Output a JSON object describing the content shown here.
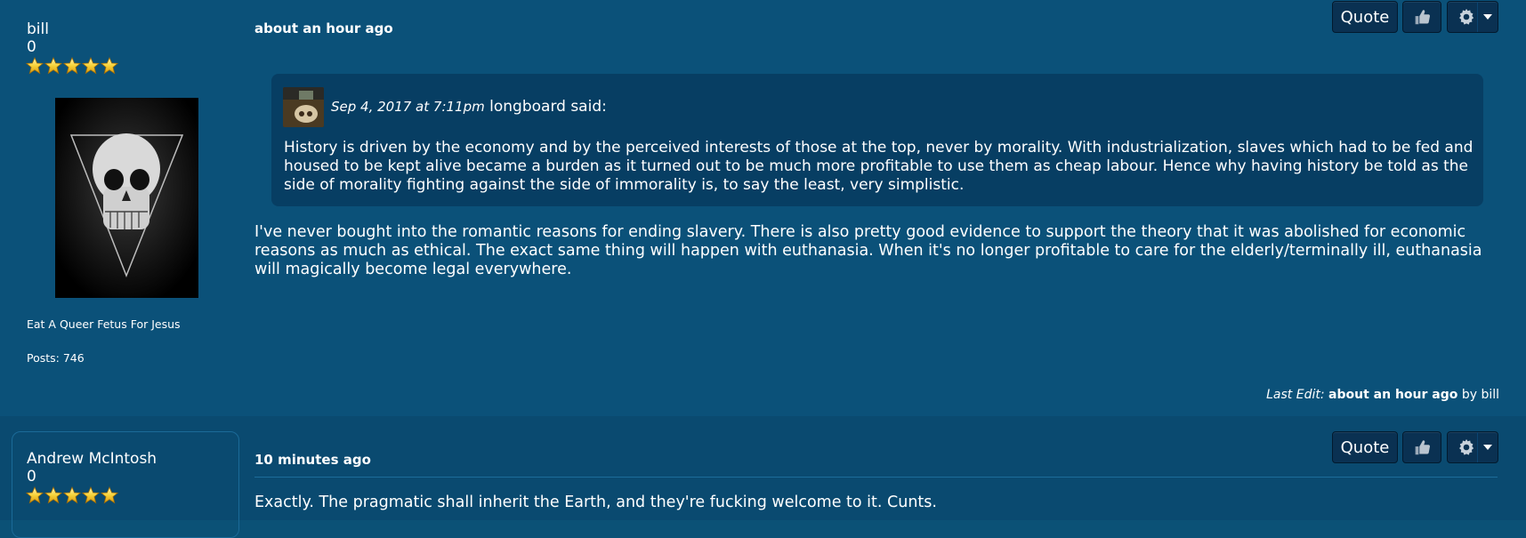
{
  "posts": [
    {
      "author": "bill",
      "reputation": "0",
      "stars": 5,
      "user_title": "Eat A Queer Fetus For Jesus",
      "post_count": "Posts: 746",
      "timestamp": "about an hour ago",
      "quote": {
        "date": "Sep 4, 2017 at 7:11pm",
        "author": "longboard",
        "said": "said:",
        "text": "History is driven by the economy and by the perceived interests of those at the top, never by morality. With industrialization, slaves which had to be fed and housed to be kept alive became a burden as it turned out to be much more profitable to use them as cheap labour. Hence why having history be told as the side of morality fighting against the side of immorality is, to say the least, very simplistic."
      },
      "body": "I've never bought into the romantic reasons for ending slavery. There is also pretty good evidence to support the theory that it was abolished for economic reasons as much as ethical. The exact same thing will happen with euthanasia. When it's no longer profitable to care for the elderly/terminally ill, euthanasia will magically become legal everywhere.",
      "last_edit": {
        "label": "Last Edit:",
        "when": "about an hour ago",
        "by_label": "by",
        "by_user": "bill"
      }
    },
    {
      "author": "Andrew McIntosh",
      "reputation": "0",
      "stars": 5,
      "timestamp": "10 minutes ago",
      "body": "Exactly. The pragmatic shall inherit the Earth, and they're fucking welcome to it. Cunts."
    }
  ],
  "buttons": {
    "quote_label": "Quote",
    "like_icon": "thumbs-up-icon",
    "options_icon": "gear-icon"
  },
  "colors": {
    "background": "#0b5179",
    "post_alt_background": "#0a4a70",
    "quote_background": "#073e63",
    "button_background": "#0a3152",
    "star": "#f5cd2b"
  }
}
